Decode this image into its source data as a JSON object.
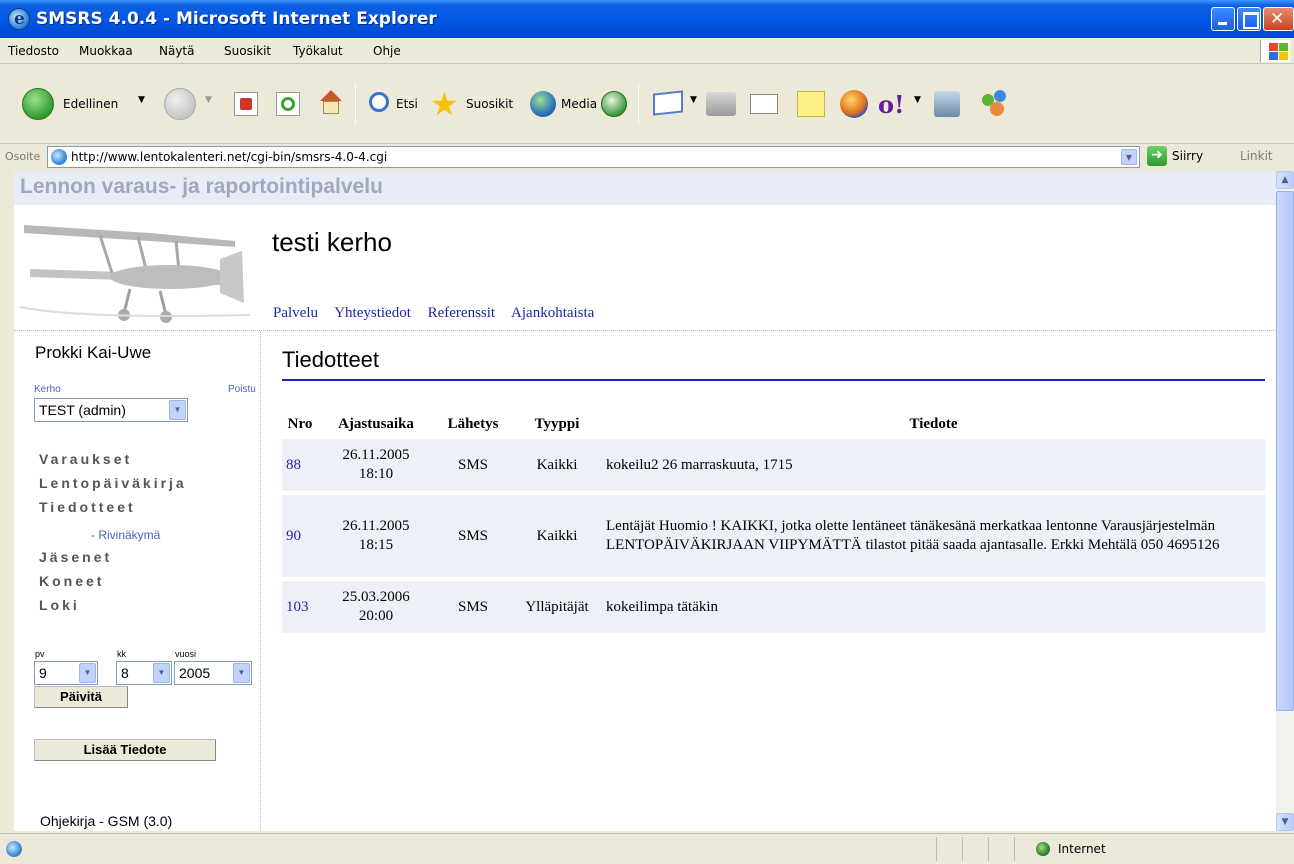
{
  "window": {
    "title": "SMSRS 4.0.4 - Microsoft Internet Explorer"
  },
  "menu": {
    "items": [
      "Tiedosto",
      "Muokkaa",
      "Näytä",
      "Suosikit",
      "Työkalut",
      "Ohje"
    ]
  },
  "toolbar": {
    "back_label": "Edellinen",
    "search_label": "Etsi",
    "favorites_label": "Suosikit",
    "media_label": "Media"
  },
  "address": {
    "label": "Osoite",
    "url": "http://www.lentokalenteri.net/cgi-bin/smsrs-4.0-4.cgi",
    "go_label": "Siirry",
    "links_label": "Linkit"
  },
  "site": {
    "banner_title": "Lennon varaus- ja raportointipalvelu",
    "club_name": "testi kerho",
    "nav": [
      "Palvelu",
      "Yhteystiedot",
      "Referenssit",
      "Ajankohtaista"
    ]
  },
  "sidebar": {
    "user_name": "Prokki Kai-Uwe",
    "club_link": "Kerho",
    "logout_link": "Poistu",
    "club_select": "TEST (admin)",
    "menu": [
      "Varaukset",
      "Lentopäiväkirja",
      "Tiedotteet",
      "Jäsenet",
      "Koneet",
      "Loki"
    ],
    "sub_item": "- Rivinäkymä",
    "date_labels": {
      "day": "pv",
      "month": "kk",
      "year": "vuosi"
    },
    "date_values": {
      "day": "9",
      "month": "8",
      "year": "2005"
    },
    "update_button": "Päivitä",
    "add_button": "Lisää Tiedote",
    "help_link": "Ohjekirja - GSM (3.0)"
  },
  "main": {
    "heading": "Tiedotteet",
    "columns": [
      "Nro",
      "Ajastusaika",
      "Lähetys",
      "Tyyppi",
      "Tiedote"
    ],
    "rows": [
      {
        "nro": "88",
        "date": "26.11.2005",
        "time": "18:10",
        "send": "SMS",
        "type": "Kaikki",
        "text": "kokeilu2 26 marraskuuta, 1715"
      },
      {
        "nro": "90",
        "date": "26.11.2005",
        "time": "18:15",
        "send": "SMS",
        "type": "Kaikki",
        "text": "Lentäjät Huomio ! KAIKKI, jotka olette lentäneet tänäkesänä merkatkaa lentonne Varausjärjestelmän LENTOPÄIVÄKIRJAAN VIIPYMÄTTÄ tilastot pitää saada ajantasalle. Erkki Mehtälä 050 4695126"
      },
      {
        "nro": "103",
        "date": "25.03.2006",
        "time": "20:00",
        "send": "SMS",
        "type": "Ylläpitäjät",
        "text": "kokeilimpa tätäkin"
      }
    ]
  },
  "status": {
    "zone": "Internet"
  }
}
